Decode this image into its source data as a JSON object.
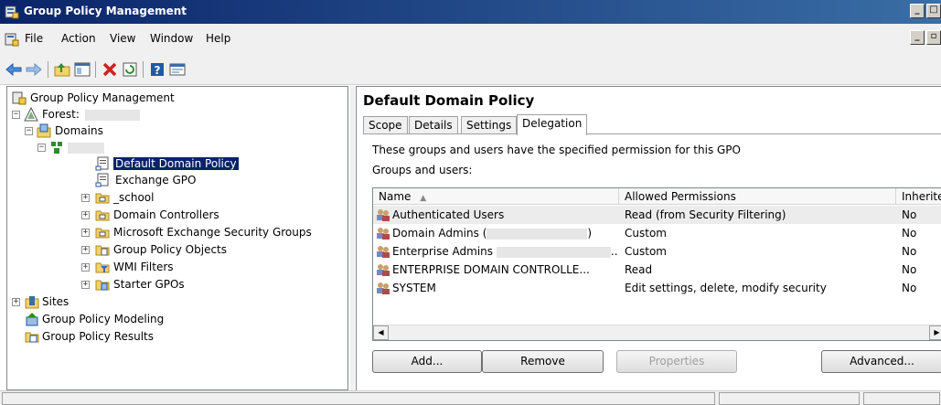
{
  "window": {
    "title": "Group Policy Management"
  },
  "menu": [
    "File",
    "Action",
    "View",
    "Window",
    "Help"
  ],
  "toolbar": {
    "icons": [
      "back-arrow-icon",
      "forward-arrow-icon",
      "up-folder-icon",
      "show-hide-console-tree-icon",
      "delete-icon",
      "refresh-icon",
      "help-icon",
      "properties-icon"
    ]
  },
  "tree": {
    "root": "Group Policy Management",
    "forest": "Forest:",
    "domains": "Domains",
    "domain_items": [
      "Default Domain Policy",
      "Exchange GPO",
      "_school",
      "Domain Controllers",
      "Microsoft Exchange Security Groups",
      "Group Policy Objects",
      "WMI Filters",
      "Starter GPOs"
    ],
    "sites": "Sites",
    "modeling": "Group Policy Modeling",
    "results": "Group Policy Results"
  },
  "details": {
    "title": "Default Domain Policy",
    "tabs": [
      "Scope",
      "Details",
      "Settings",
      "Delegation"
    ],
    "active_tab": "Delegation",
    "description": "These groups and users have the specified permission for this GPO",
    "groups_label": "Groups and users:",
    "columns": [
      "Name",
      "Allowed Permissions",
      "Inherited"
    ],
    "rows": [
      {
        "name": "Authenticated Users",
        "permission": "Read (from Security Filtering)",
        "inherited": "No"
      },
      {
        "name": "Domain Admins (",
        "name_suffix": ")",
        "permission": "Custom",
        "inherited": "No"
      },
      {
        "name": "Enterprise Admins",
        "name_suffix": "..",
        "permission": "Custom",
        "inherited": "No"
      },
      {
        "name": "ENTERPRISE DOMAIN CONTROLLE...",
        "permission": "Read",
        "inherited": "No"
      },
      {
        "name": "SYSTEM",
        "permission": "Edit settings, delete, modify security",
        "inherited": "No"
      }
    ],
    "buttons": {
      "add": "Add...",
      "remove": "Remove",
      "properties": "Properties",
      "advanced": "Advanced..."
    }
  }
}
